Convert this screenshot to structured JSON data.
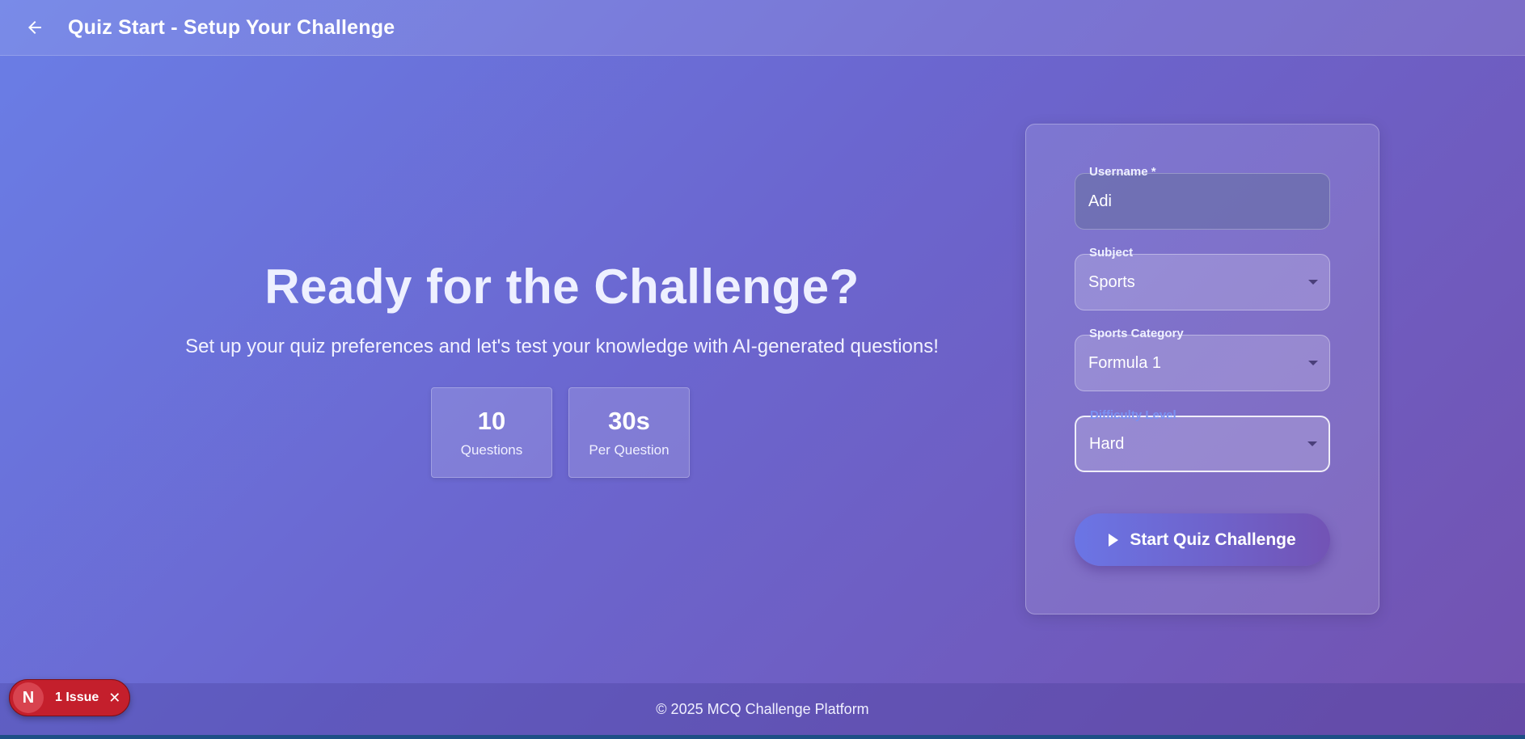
{
  "appbar": {
    "back_icon": "arrow-left-icon",
    "title": "Quiz Start - Setup Your Challenge"
  },
  "hero": {
    "heading": "Ready for the Challenge?",
    "subheading": "Set up your quiz preferences and let's test your knowledge with AI-generated questions!"
  },
  "stats": [
    {
      "value": "10",
      "label": "Questions"
    },
    {
      "value": "30s",
      "label": "Per Question"
    }
  ],
  "form": {
    "username": {
      "label": "Username *",
      "value": "Adi"
    },
    "subject": {
      "label": "Subject",
      "value": "Sports"
    },
    "sports_category": {
      "label": "Sports Category",
      "value": "Formula 1"
    },
    "difficulty": {
      "label": "Difficulty Level",
      "value": "Hard"
    },
    "start_button": {
      "label": "Start Quiz Challenge",
      "icon": "play-icon"
    }
  },
  "footer": {
    "text": "© 2025 MCQ Challenge Platform"
  },
  "dev_overlay": {
    "logo": "N",
    "label": "1 Issue",
    "close_icon": "close-icon"
  },
  "colors": {
    "accent": "#7a90f2",
    "badge": "#c41f2c"
  }
}
